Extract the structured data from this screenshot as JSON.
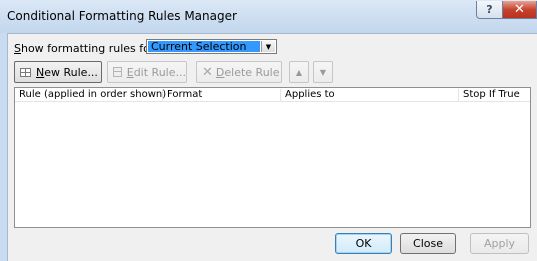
{
  "window": {
    "title": "Conditional Formatting Rules Manager"
  },
  "titlebar": {
    "help_glyph": "?",
    "close_glyph": "✕"
  },
  "show_rules": {
    "label_prefix": "S",
    "label_rest": "how formatting rules for:",
    "selected": "Current Selection"
  },
  "toolbar": {
    "new_rule_ul": "N",
    "new_rule_rest": "ew Rule...",
    "edit_rule_ul": "E",
    "edit_rule_rest": "dit Rule...",
    "delete_rule_ul": "D",
    "delete_rule_rest": "elete Rule",
    "move_up_glyph": "▲",
    "move_down_glyph": "▼"
  },
  "table": {
    "columns": [
      "Rule (applied in order shown)",
      "Format",
      "Applies to",
      "Stop If True"
    ],
    "rows": []
  },
  "footer": {
    "ok_label": "OK",
    "close_label": "Close",
    "apply_label": "Apply"
  }
}
